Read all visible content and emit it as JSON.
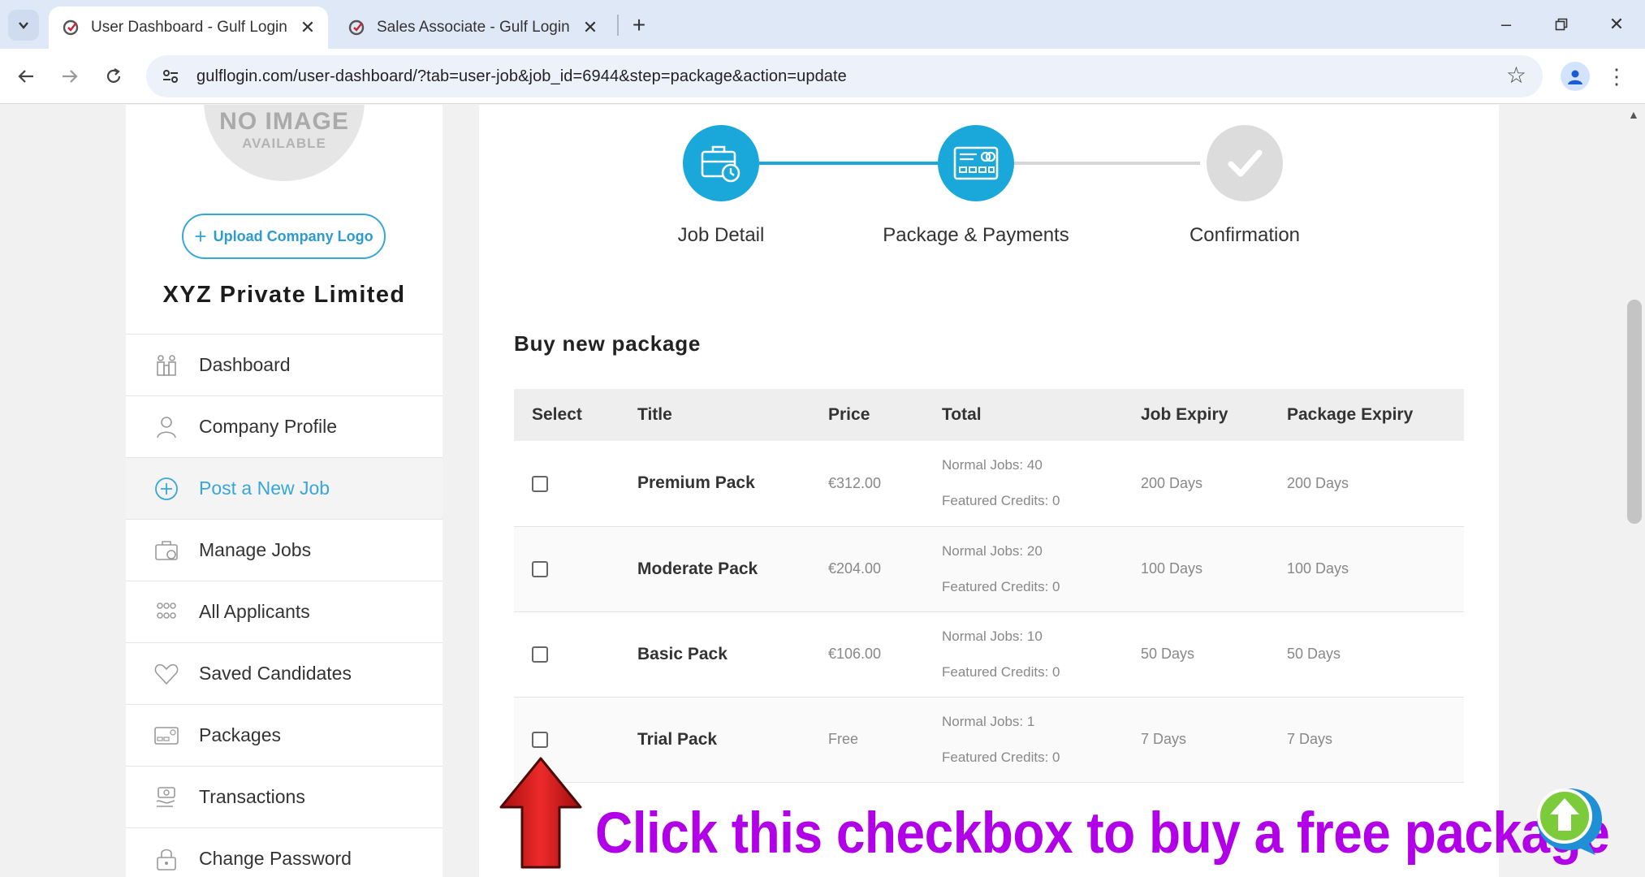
{
  "browser": {
    "tabs": [
      {
        "title": "User Dashboard - Gulf Login",
        "active": true
      },
      {
        "title": "Sales Associate - Gulf Login",
        "active": false
      }
    ],
    "url": "gulflogin.com/user-dashboard/?tab=user-job&job_id=6944&step=package&action=update"
  },
  "sidebar": {
    "no_image_big": "NO IMAGE",
    "no_image_small": "AVAILABLE",
    "upload_label": "Upload Company Logo",
    "company_name": "XYZ Private Limited",
    "items": [
      {
        "label": "Dashboard",
        "icon": "dashboard-icon"
      },
      {
        "label": "Company Profile",
        "icon": "user-icon"
      },
      {
        "label": "Post a New Job",
        "icon": "plus-circle-icon",
        "active": true
      },
      {
        "label": "Manage Jobs",
        "icon": "briefcase-icon"
      },
      {
        "label": "All Applicants",
        "icon": "group-icon"
      },
      {
        "label": "Saved Candidates",
        "icon": "heart-icon"
      },
      {
        "label": "Packages",
        "icon": "card-icon"
      },
      {
        "label": "Transactions",
        "icon": "transactions-icon"
      },
      {
        "label": "Change Password",
        "icon": "lock-icon"
      }
    ]
  },
  "steps": [
    {
      "label": "Job Detail",
      "state": "done"
    },
    {
      "label": "Package & Payments",
      "state": "current"
    },
    {
      "label": "Confirmation",
      "state": "todo"
    }
  ],
  "packages": {
    "title": "Buy new package",
    "columns": [
      "Select",
      "Title",
      "Price",
      "Total",
      "Job Expiry",
      "Package Expiry"
    ],
    "rows": [
      {
        "title": "Premium Pack",
        "price": "€312.00",
        "normal_jobs": "Normal Jobs: 40",
        "featured": "Featured Credits: 0",
        "job_expiry": "200 Days",
        "package_expiry": "200 Days"
      },
      {
        "title": "Moderate Pack",
        "price": "€204.00",
        "normal_jobs": "Normal Jobs: 20",
        "featured": "Featured Credits: 0",
        "job_expiry": "100 Days",
        "package_expiry": "100 Days"
      },
      {
        "title": "Basic Pack",
        "price": "€106.00",
        "normal_jobs": "Normal Jobs: 10",
        "featured": "Featured Credits: 0",
        "job_expiry": "50 Days",
        "package_expiry": "50 Days"
      },
      {
        "title": "Trial Pack",
        "price": "Free",
        "normal_jobs": "Normal Jobs: 1",
        "featured": "Featured Credits: 0",
        "job_expiry": "7 Days",
        "package_expiry": "7 Days"
      }
    ]
  },
  "annotation": {
    "text": "Click this checkbox to buy a free package",
    "color": "#b100e8",
    "arrow_color": "#d81c1c"
  },
  "colors": {
    "accent": "#1aa7d9"
  }
}
